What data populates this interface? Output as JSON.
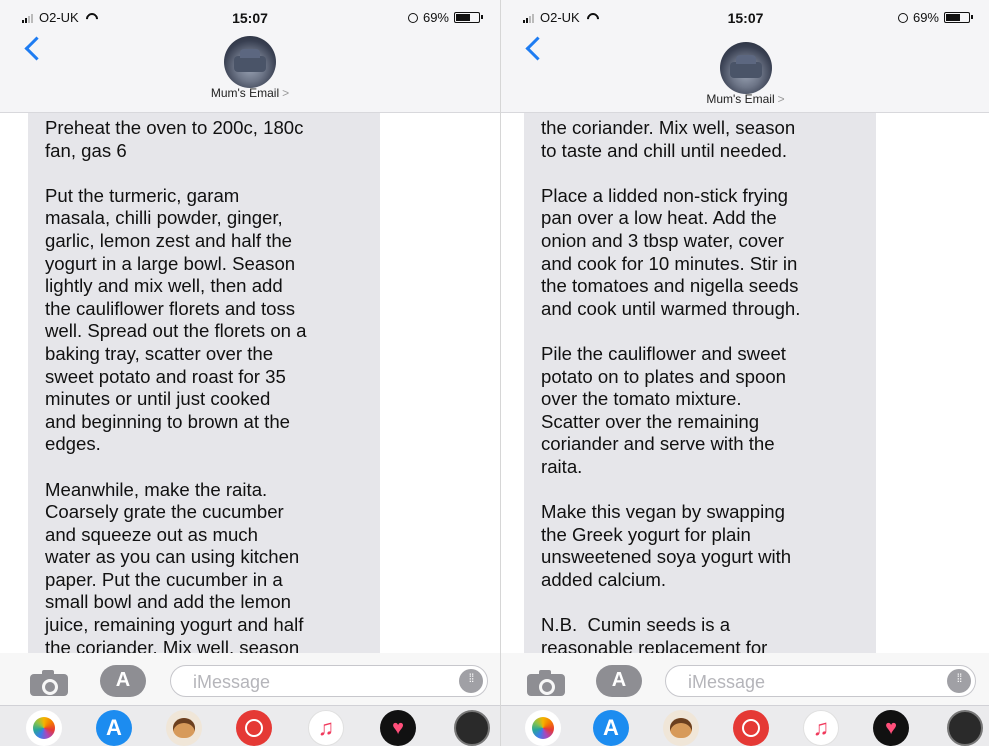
{
  "screens": [
    {
      "status": {
        "carrier": "O2-UK",
        "time": "15:07",
        "battery": "69%",
        "battery_level": 0.69
      },
      "contact": "Mum's Email",
      "message": "Preheat the oven to 200c, 180c\nfan, gas 6\n\nPut the turmeric, garam\nmasala, chilli powder, ginger,\ngarlic, lemon zest and half the\nyogurt in a large bowl. Season\nlightly and mix well, then add\nthe cauliflower florets and toss\nwell. Spread out the florets on a\nbaking tray, scatter over the\nsweet potato and roast for 35\nminutes or until just cooked\nand beginning to brown at the\nedges.\n\nMeanwhile, make the raita.\nCoarsely grate the cucumber\nand squeeze out as much\nwater as you can using kitchen\npaper. Put the cucumber in a\nsmall bowl and add the lemon\njuice, remaining yogurt and half\nthe coriander. Mix well, season",
      "compose_placeholder": "iMessage"
    },
    {
      "status": {
        "carrier": "O2-UK",
        "time": "15:07",
        "battery": "69%",
        "battery_level": 0.69
      },
      "contact": "Mum's Email",
      "message": "the coriander. Mix well, season\nto taste and chill until needed.\n\nPlace a lidded non-stick frying\npan over a low heat. Add the\nonion and 3 tbsp water, cover\nand cook for 10 minutes. Stir in\nthe tomatoes and nigella seeds\nand cook until warmed through.\n\nPile the cauliflower and sweet\npotato on to plates and spoon\nover the tomato mixture.\nScatter over the remaining\ncoriander and serve with the\nraita.\n\nMake this vegan by swapping\nthe Greek yogurt for plain\nunsweetened soya yogurt with\nadded calcium.\n\nN.B.  Cumin seeds is a\nreasonable replacement for",
      "compose_placeholder": "iMessage"
    }
  ],
  "dock_icons": [
    "photos-icon",
    "app-store-icon",
    "memoji-icon",
    "search-images-icon",
    "music-icon",
    "digital-touch-icon",
    "more-apps-icon"
  ],
  "colors": {
    "ios_blue": "#1e7cf2",
    "bubble_gray": "#e6e6ea",
    "header_bg": "#f5f5f7"
  }
}
